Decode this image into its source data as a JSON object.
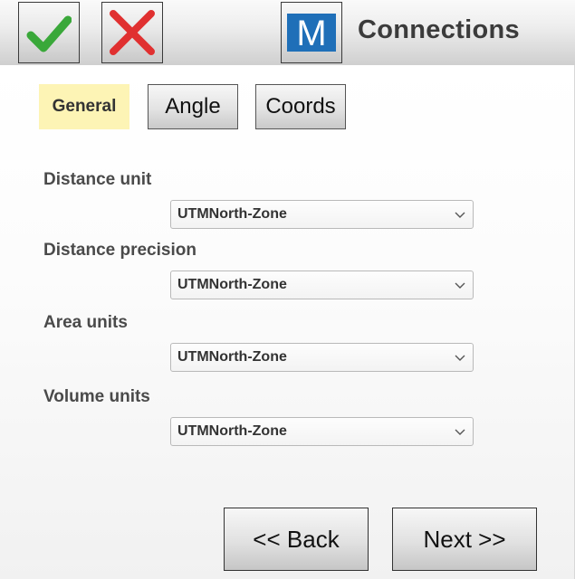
{
  "header": {
    "title": "Connections",
    "confirm_icon": "checkmark-icon",
    "cancel_icon": "close-icon",
    "logo_icon": "m-logo-icon",
    "logo_letter": "M"
  },
  "tabs": [
    {
      "label": "General",
      "active": true
    },
    {
      "label": "Angle",
      "active": false
    },
    {
      "label": "Coords",
      "active": false
    }
  ],
  "fields": [
    {
      "label": "Distance unit",
      "value": "UTMNorth-Zone"
    },
    {
      "label": "Distance precision",
      "value": "UTMNorth-Zone"
    },
    {
      "label": "Area units",
      "value": "UTMNorth-Zone"
    },
    {
      "label": "Volume units",
      "value": "UTMNorth-Zone"
    }
  ],
  "nav": {
    "back_label": "<< Back",
    "next_label": "Next >>"
  },
  "colors": {
    "check_green": "#3aa83a",
    "cross_red": "#e03030",
    "logo_blue": "#1f6fb8",
    "active_tab": "#fdf4b5"
  }
}
